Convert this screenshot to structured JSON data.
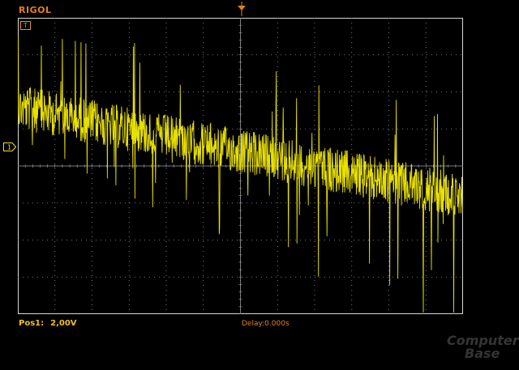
{
  "header": {
    "brand": "RIGOL"
  },
  "channel": {
    "tag": "T",
    "marker": "1",
    "color": "#f0e020",
    "trace_color": "#e8e000"
  },
  "status": {
    "pos_label": "Pos1:",
    "pos_value": "2,00V",
    "delay": "Delay:0.000s"
  },
  "watermark": {
    "line1": "Computer",
    "line2": "Base"
  },
  "colors": {
    "accent": "#e08020",
    "grid": "#9a9a9a",
    "frame": "#d8d8d8",
    "trace": "#e8e000"
  }
}
